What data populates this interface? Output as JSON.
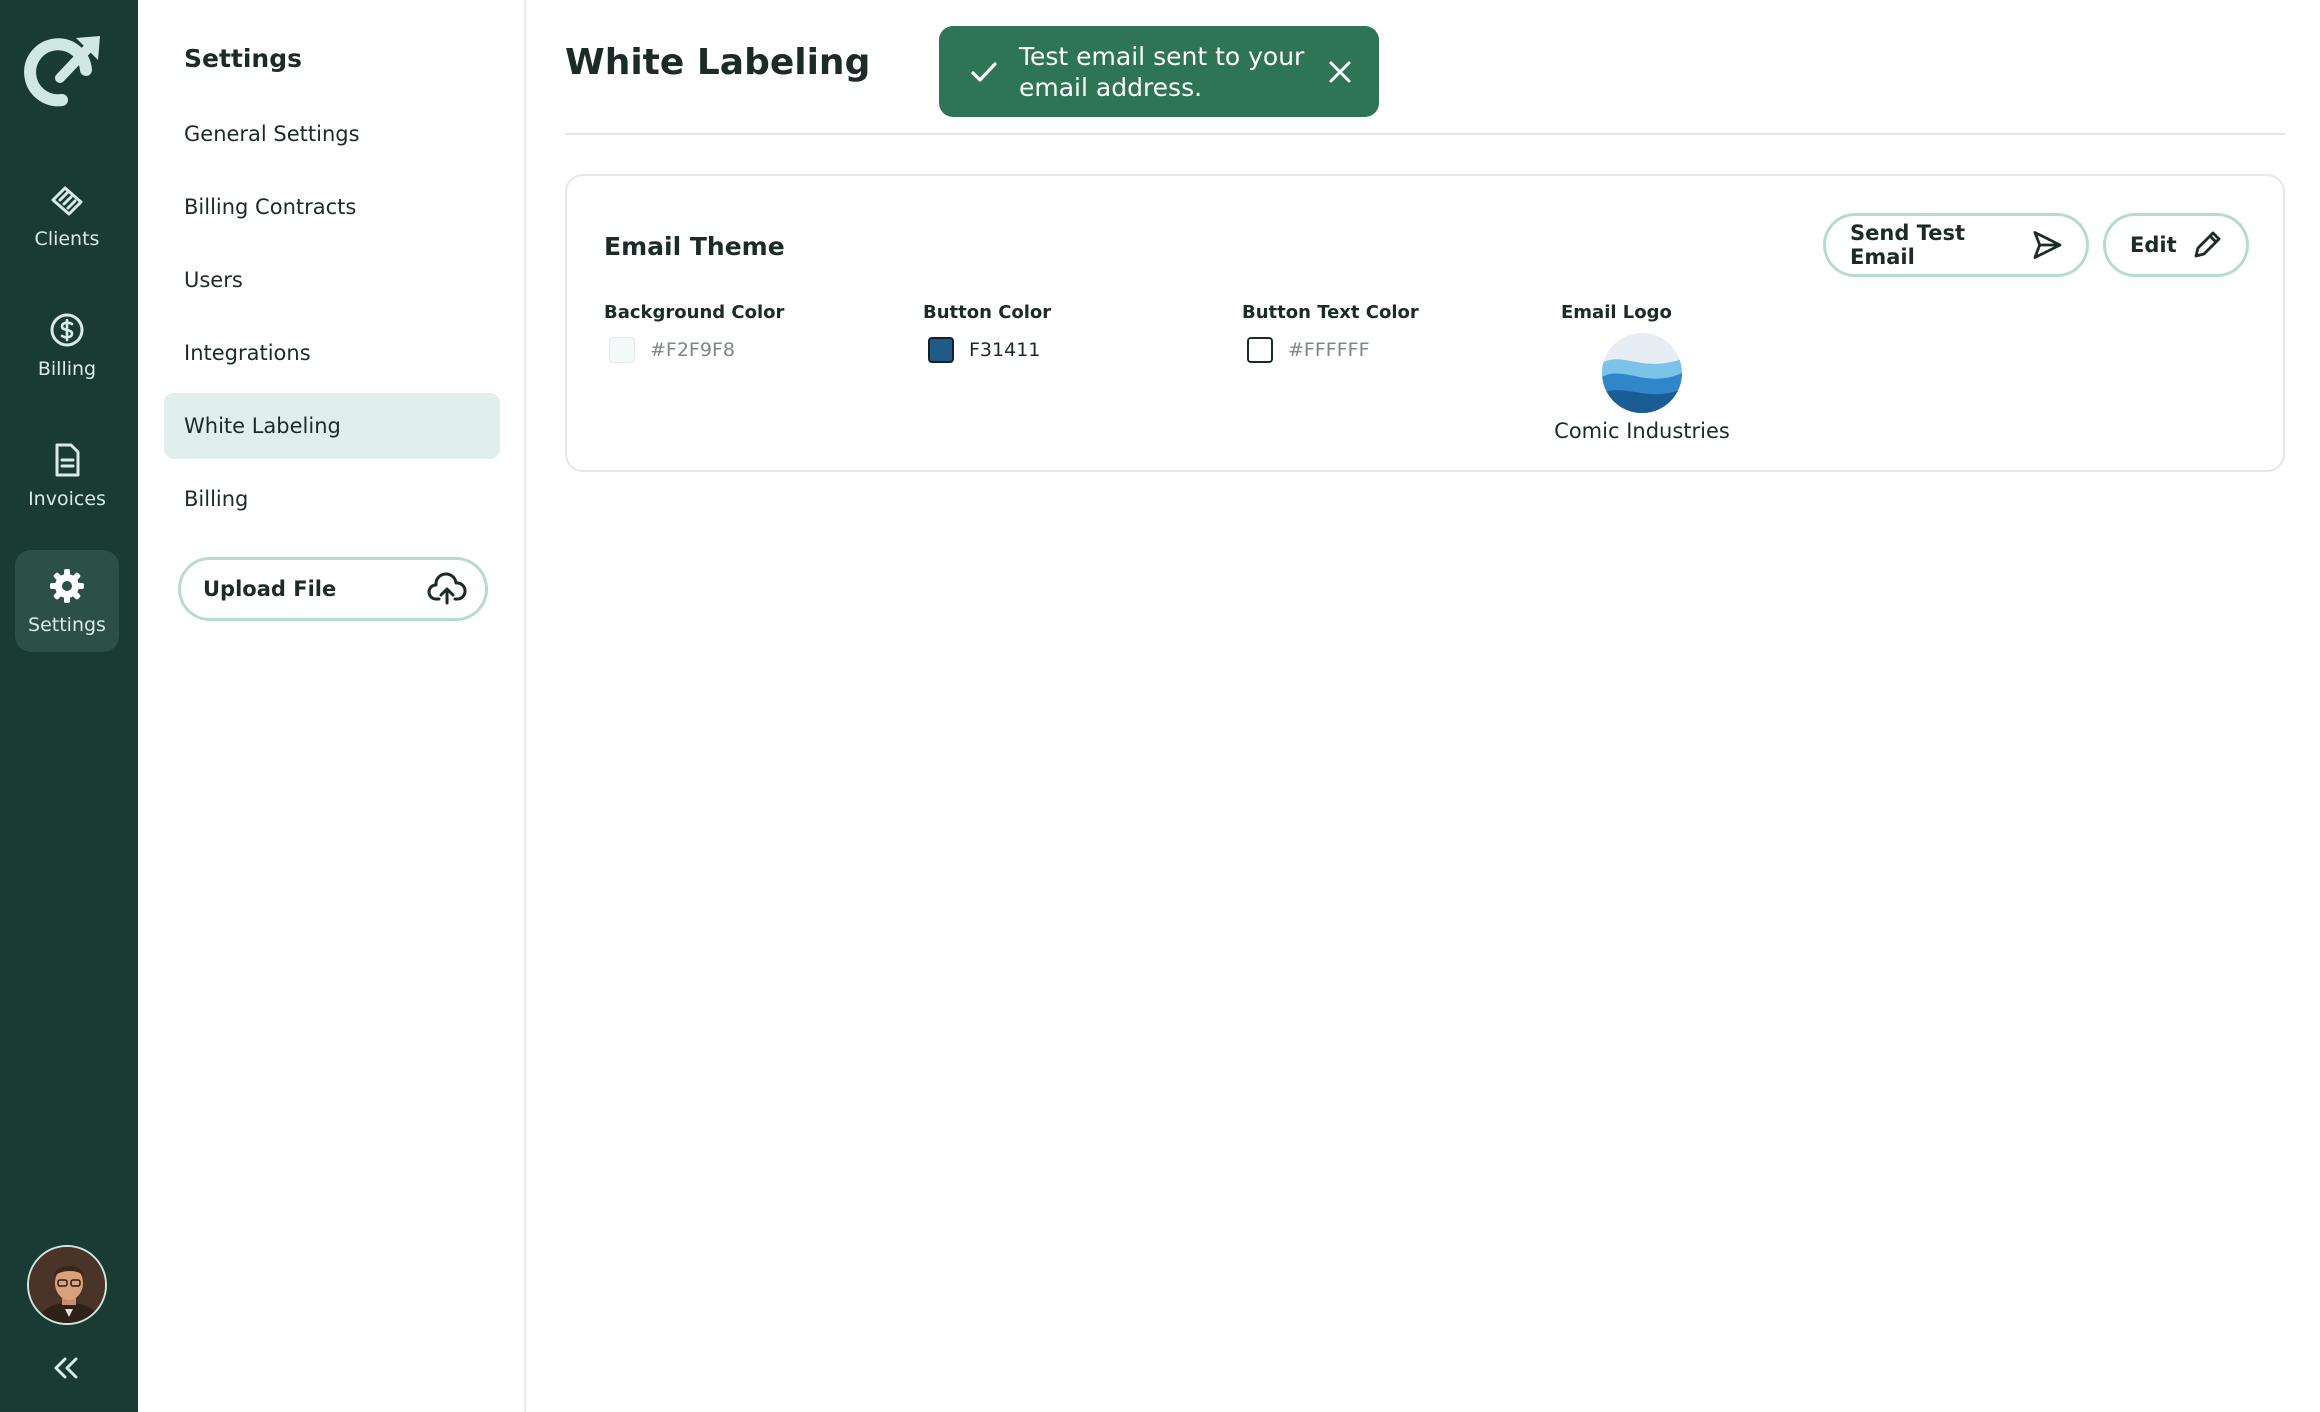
{
  "rail": {
    "items": [
      {
        "label": "Clients",
        "icon": "handshake-icon"
      },
      {
        "label": "Billing",
        "icon": "dollar-circle-icon"
      },
      {
        "label": "Invoices",
        "icon": "document-icon"
      },
      {
        "label": "Settings",
        "icon": "gear-icon"
      }
    ],
    "active": "Settings"
  },
  "panel": {
    "title": "Settings",
    "items": [
      {
        "label": "General Settings"
      },
      {
        "label": "Billing Contracts"
      },
      {
        "label": "Users"
      },
      {
        "label": "Integrations"
      },
      {
        "label": "White Labeling"
      },
      {
        "label": "Billing"
      }
    ],
    "active": "White Labeling",
    "upload_label": "Upload File"
  },
  "main": {
    "title": "White Labeling",
    "toast": {
      "message": "Test email sent to your email address."
    },
    "card": {
      "title": "Email Theme",
      "send_test_label": "Send Test Email",
      "edit_label": "Edit",
      "fields": [
        {
          "label": "Background Color",
          "value": "#F2F9F8",
          "swatch": "#F2F9F8"
        },
        {
          "label": "Button Color",
          "value": "F31411",
          "swatch": "#1E5B86"
        },
        {
          "label": "Button Text Color",
          "value": "#FFFFFF",
          "swatch": "#FFFFFF"
        },
        {
          "label": "Email Logo",
          "value": "Comic Industries"
        }
      ]
    }
  },
  "colors": {
    "rail_bg": "#1A3A34",
    "toast_bg": "#2E7555",
    "active_nav_bg": "#E0EFEB",
    "pill_border": "#B7DBD2"
  }
}
